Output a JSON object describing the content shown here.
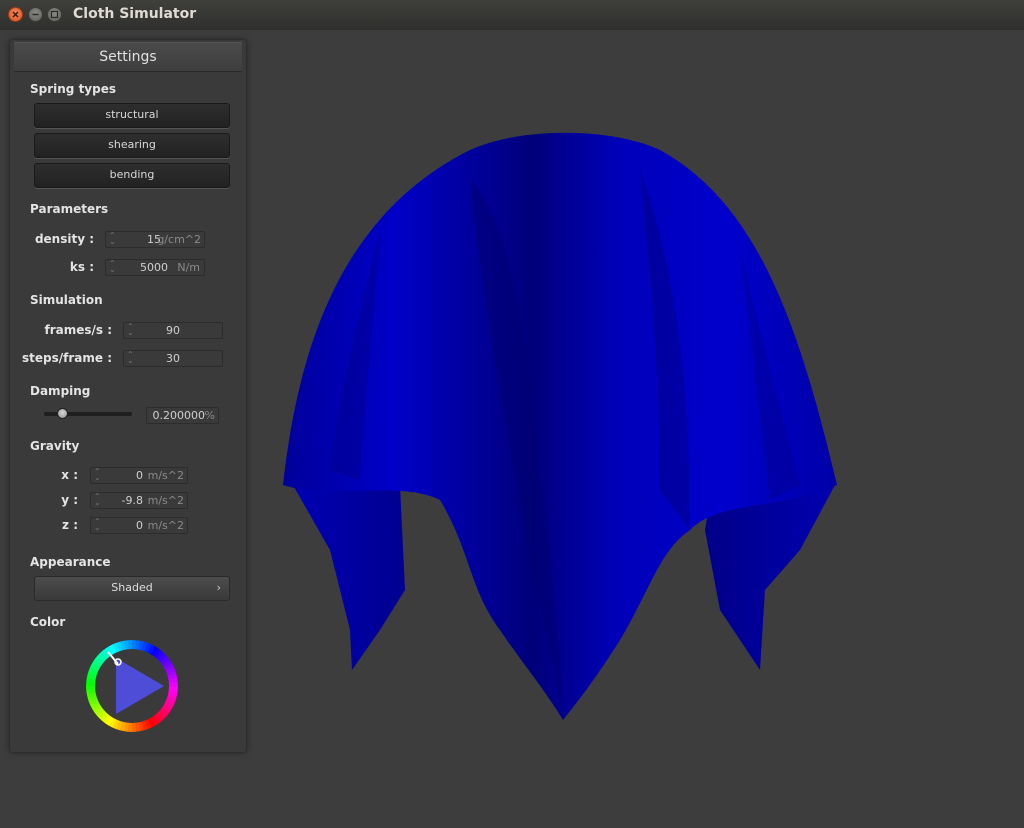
{
  "window": {
    "title": "Cloth Simulator"
  },
  "panel": {
    "header": "Settings",
    "spring_types": {
      "label": "Spring types",
      "buttons": [
        "structural",
        "shearing",
        "bending"
      ]
    },
    "parameters": {
      "label": "Parameters",
      "density": {
        "label": "density :",
        "value": "15",
        "unit": "g/cm^2"
      },
      "ks": {
        "label": "ks :",
        "value": "5000",
        "unit": "N/m"
      }
    },
    "simulation": {
      "label": "Simulation",
      "fps": {
        "label": "frames/s :",
        "value": "90"
      },
      "steps": {
        "label": "steps/frame :",
        "value": "30"
      }
    },
    "damping": {
      "label": "Damping",
      "value": "0.200000",
      "unit": "%",
      "slider_fraction": 0.2
    },
    "gravity": {
      "label": "Gravity",
      "x": {
        "label": "x :",
        "value": "0",
        "unit": "m/s^2"
      },
      "y": {
        "label": "y :",
        "value": "-9.8",
        "unit": "m/s^2"
      },
      "z": {
        "label": "z :",
        "value": "0",
        "unit": "m/s^2"
      }
    },
    "appearance": {
      "label": "Appearance",
      "selected": "Shaded",
      "chevron": "›"
    },
    "color": {
      "label": "Color",
      "value": "#0000cc"
    }
  },
  "colors": {
    "cloth": "#0000c8",
    "background": "#3d3d3d",
    "panel": "#3a3a3a"
  },
  "icons": {
    "close": "close-icon",
    "minimize": "minimize-icon",
    "maximize": "maximize-icon",
    "spin": "spinner-arrows-icon"
  }
}
